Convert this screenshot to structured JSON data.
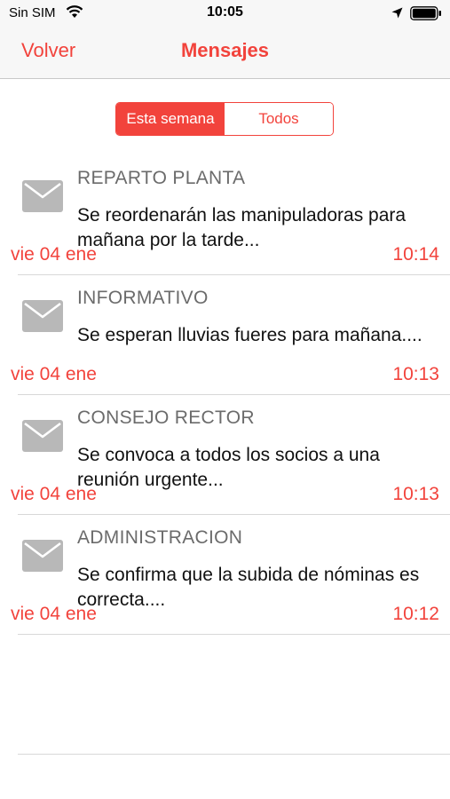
{
  "status_bar": {
    "carrier": "Sin SIM",
    "time": "10:05",
    "icons": [
      "wifi-icon",
      "location-icon",
      "battery-icon"
    ]
  },
  "nav": {
    "back_label": "Volver",
    "title": "Mensajes"
  },
  "segments": {
    "this_week": "Esta semana",
    "all": "Todos",
    "selected": "Esta semana"
  },
  "colors": {
    "accent": "#f2433c",
    "sender": "#6b6b6b",
    "icon": "#b8b8b8"
  },
  "messages": [
    {
      "sender": "REPARTO PLANTA",
      "body": "Se reordenarán las manipuladoras para mañana por la tarde...",
      "date": "vie 04 ene",
      "time": "10:14",
      "icon": "mail-icon"
    },
    {
      "sender": "INFORMATIVO",
      "body": "Se esperan lluvias fueres para mañana....",
      "date": "vie 04 ene",
      "time": "10:13",
      "icon": "mail-icon"
    },
    {
      "sender": "CONSEJO RECTOR",
      "body": "Se convoca a todos los socios a una reunión urgente...",
      "date": "vie 04 ene",
      "time": "10:13",
      "icon": "mail-icon"
    },
    {
      "sender": "ADMINISTRACION",
      "body": "Se confirma que la subida de nóminas es correcta....",
      "date": "vie 04 ene",
      "time": "10:12",
      "icon": "mail-icon"
    }
  ]
}
